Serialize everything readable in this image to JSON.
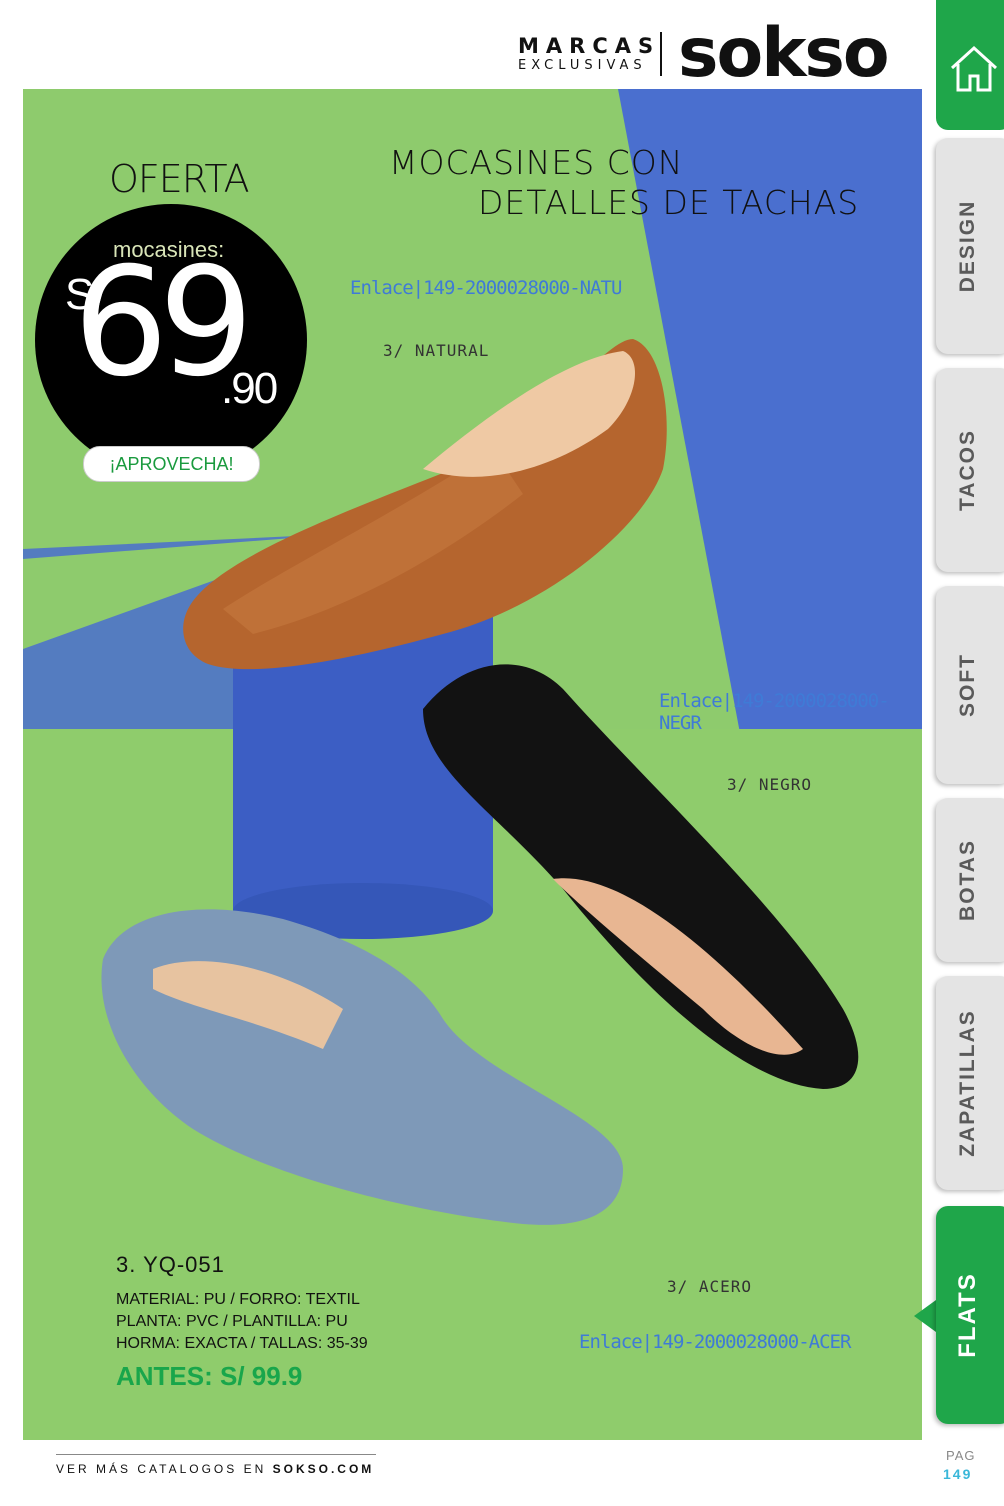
{
  "header": {
    "brand_line1": "MARCAS",
    "brand_line2": "EXCLUSIVAS",
    "logo": "sokso"
  },
  "promo": {
    "oferta": "OFERTA",
    "subtitle": "mocasines:",
    "currency": "S/",
    "price_whole": "69",
    "price_cents": ".90",
    "cta": "¡APROVECHA!"
  },
  "title": {
    "line1": "MOCASINES CON",
    "line2": "DETALLES DE TACHAS"
  },
  "variants": [
    {
      "link": "Enlace|149-2000028000-NATU",
      "label": "3/ NATURAL",
      "color": "#b5652e"
    },
    {
      "link": "Enlace|149-2000028000-NEGR",
      "label": "3/ NEGRO",
      "color": "#111111"
    },
    {
      "link": "Enlace|149-2000028000-ACER",
      "label": "3/ ACERO",
      "color": "#7e99b8"
    }
  ],
  "product": {
    "code": "3. YQ-051",
    "spec1": "MATERIAL: PU / FORRO: TEXTIL",
    "spec2": "PLANTA: PVC / PLANTILLA: PU",
    "spec3": "HORMA: EXACTA / TALLAS: 35-39",
    "antes": "ANTES: S/ 99.9"
  },
  "footer": {
    "prefix": "VER MÁS CATALOGOS EN",
    "site": "SOKSO.COM",
    "pag_label": "PAG",
    "pag_number": "149"
  },
  "nav": {
    "home_icon": "home-icon",
    "tabs": [
      {
        "label": "DESIGN",
        "active": false
      },
      {
        "label": "TACOS",
        "active": false
      },
      {
        "label": "SOFT",
        "active": false
      },
      {
        "label": "BOTAS",
        "active": false
      },
      {
        "label": "ZAPATILLAS",
        "active": false
      },
      {
        "label": "FLATS",
        "active": true
      }
    ]
  },
  "colors": {
    "accent_green": "#1fa64a",
    "panel_green": "#8ecb6d",
    "panel_blue": "#4a6fcf",
    "link_blue": "#3f7bd6"
  }
}
